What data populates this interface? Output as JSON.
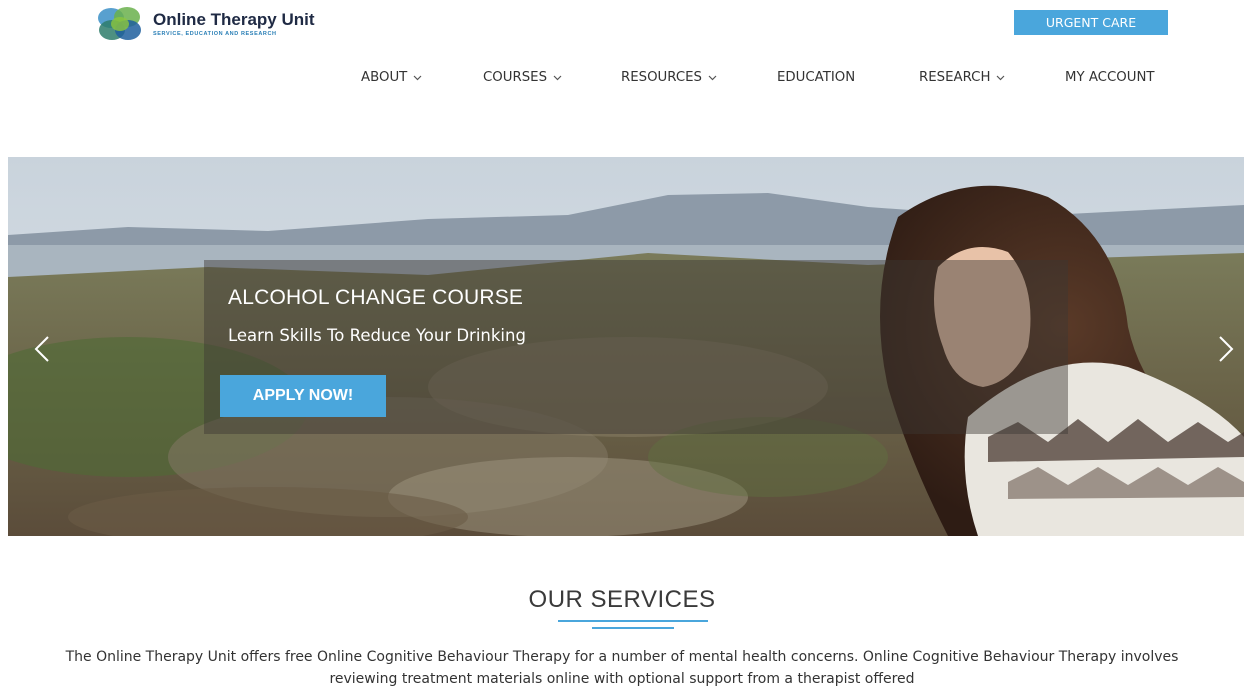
{
  "header": {
    "logo_title": "Online Therapy Unit",
    "logo_subtitle": "SERVICE, EDUCATION AND RESEARCH",
    "urgent_label": "URGENT CARE"
  },
  "nav": {
    "items": [
      {
        "label": "ABOUT",
        "has_dropdown": true
      },
      {
        "label": "COURSES",
        "has_dropdown": true
      },
      {
        "label": "RESOURCES",
        "has_dropdown": true
      },
      {
        "label": "EDUCATION",
        "has_dropdown": false
      },
      {
        "label": "RESEARCH",
        "has_dropdown": true
      },
      {
        "label": "MY ACCOUNT",
        "has_dropdown": false
      }
    ]
  },
  "hero": {
    "title": "ALCOHOL CHANGE COURSE",
    "subtitle": "Learn Skills To Reduce Your Drinking",
    "cta_label": "APPLY NOW!",
    "prev_icon": "chevron-left-icon",
    "next_icon": "chevron-right-icon"
  },
  "services": {
    "title": "OUR SERVICES",
    "body": "The Online Therapy Unit offers free Online Cognitive Behaviour Therapy for a number of mental health concerns. Online Cognitive Behaviour Therapy involves reviewing treatment materials online with optional support from a therapist offered"
  },
  "colors": {
    "accent": "#4aa6dc",
    "text": "#333333",
    "logo_dark": "#1f2a44"
  }
}
